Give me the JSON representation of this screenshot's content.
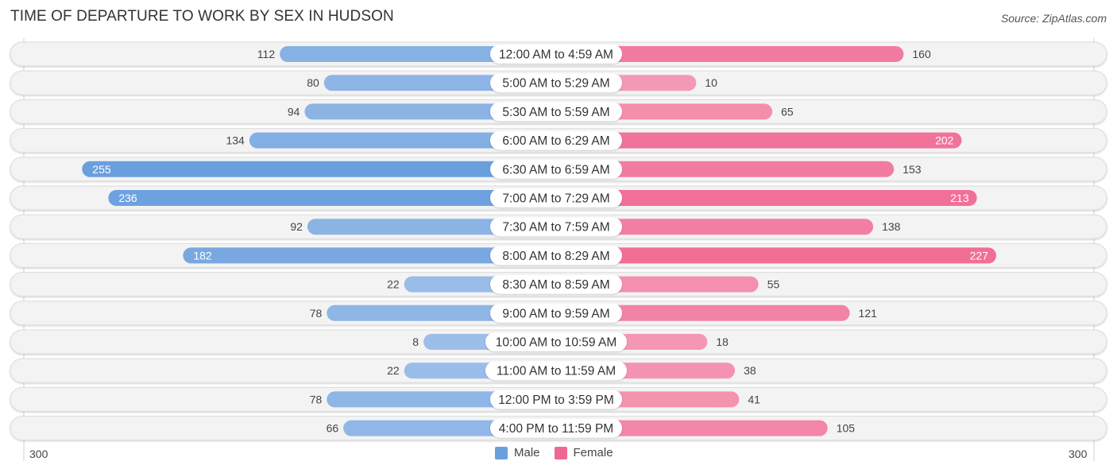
{
  "header": {
    "title": "TIME OF DEPARTURE TO WORK BY SEX IN HUDSON",
    "source": "Source: ZipAtlas.com"
  },
  "legend": {
    "male_label": "Male",
    "female_label": "Female",
    "male_color": "#6a9fde",
    "female_color": "#f06892"
  },
  "axis": {
    "left_label": "300",
    "right_label": "300"
  },
  "chart_data": {
    "type": "bar",
    "orientation": "horizontal-diverging",
    "title": "TIME OF DEPARTURE TO WORK BY SEX IN HUDSON",
    "xlabel": "",
    "ylabel": "",
    "xlim": [
      -300,
      300
    ],
    "legend_position": "bottom-center",
    "categories": [
      "12:00 AM to 4:59 AM",
      "5:00 AM to 5:29 AM",
      "5:30 AM to 5:59 AM",
      "6:00 AM to 6:29 AM",
      "6:30 AM to 6:59 AM",
      "7:00 AM to 7:29 AM",
      "7:30 AM to 7:59 AM",
      "8:00 AM to 8:29 AM",
      "8:30 AM to 8:59 AM",
      "9:00 AM to 9:59 AM",
      "10:00 AM to 10:59 AM",
      "11:00 AM to 11:59 AM",
      "12:00 PM to 3:59 PM",
      "4:00 PM to 11:59 PM"
    ],
    "series": [
      {
        "name": "Male",
        "color": "#6a9fde",
        "values": [
          112,
          80,
          94,
          134,
          255,
          236,
          92,
          182,
          22,
          78,
          8,
          22,
          78,
          66
        ]
      },
      {
        "name": "Female",
        "color": "#f06892",
        "values": [
          160,
          10,
          65,
          202,
          153,
          213,
          138,
          227,
          55,
          121,
          18,
          38,
          41,
          105
        ]
      }
    ]
  }
}
